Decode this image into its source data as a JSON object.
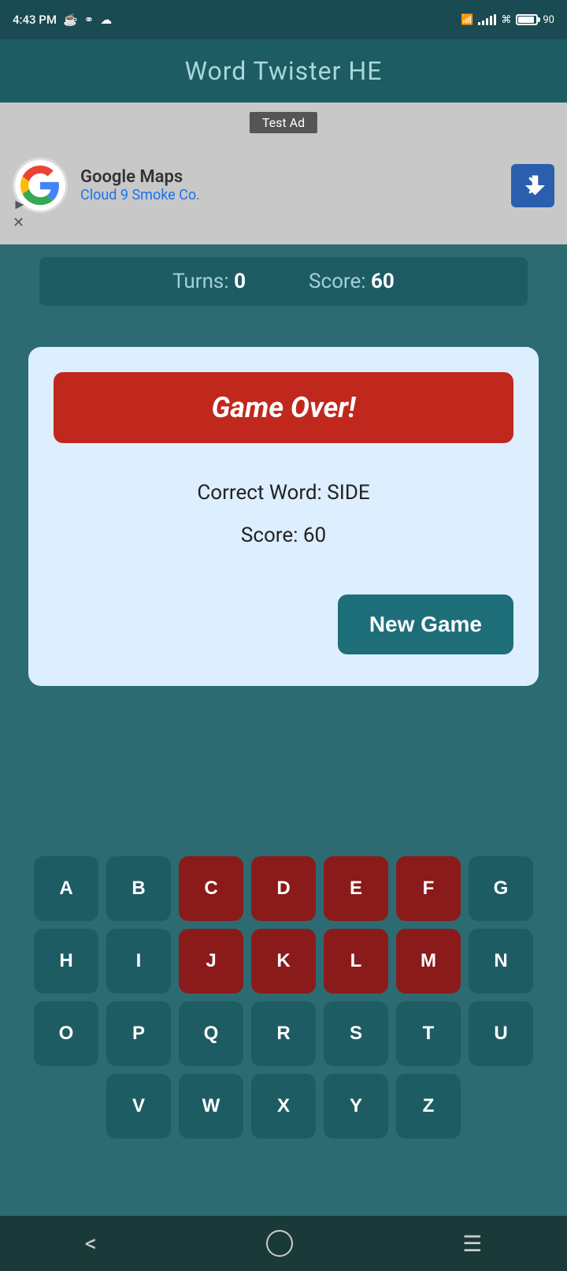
{
  "statusBar": {
    "time": "4:43 PM",
    "battery": "90"
  },
  "header": {
    "title": "Word Twister HE"
  },
  "ad": {
    "label": "Test Ad",
    "companyName": "Google Maps",
    "subtitle": "Cloud 9 Smoke Co."
  },
  "scoreBar": {
    "turnsLabel": "Turns:",
    "turnsValue": "0",
    "scoreLabel": "Score:",
    "scoreValue": "60"
  },
  "modal": {
    "gameOverLabel": "Game Over!",
    "correctWordLabel": "Correct Word: SIDE",
    "scoreLabel": "Score: 60",
    "newGameLabel": "New Game"
  },
  "keyboard": {
    "rows": [
      [
        "A",
        "B",
        "C",
        "D",
        "E",
        "F",
        "G"
      ],
      [
        "H",
        "I",
        "J",
        "K",
        "L",
        "M",
        "N"
      ],
      [
        "O",
        "P",
        "Q",
        "R",
        "S",
        "T",
        "U"
      ],
      [
        "V",
        "W",
        "X",
        "Y",
        "Z"
      ]
    ],
    "usedKeys": [
      "C",
      "D",
      "E",
      "F",
      "J",
      "K",
      "L",
      "M"
    ]
  },
  "bottomNav": {
    "back": "‹",
    "home": "○",
    "menu": "≡"
  }
}
